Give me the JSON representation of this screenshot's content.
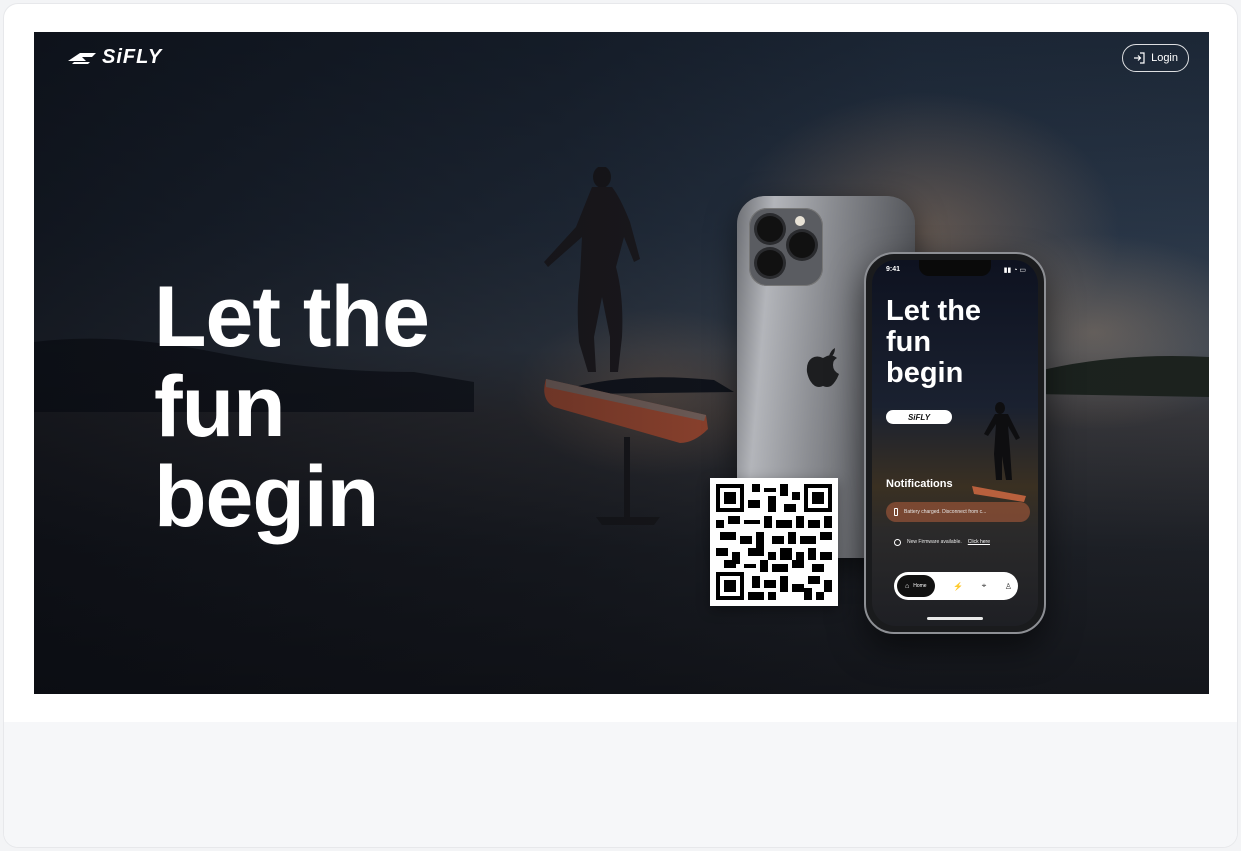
{
  "header": {
    "logo_text": "SiFLY",
    "login_label": "Login",
    "login_icon": "login-icon"
  },
  "hero": {
    "headline": [
      "Let the",
      "fun",
      "begin"
    ]
  },
  "phone_screen": {
    "status_time": "9:41",
    "headline": [
      "Let the",
      "fun",
      "begin"
    ],
    "logo_text": "SiFLY",
    "notifications_title": "Notifications",
    "notifications": [
      {
        "icon": "battery-icon",
        "text": "Battery charged. Disconnect from c..."
      },
      {
        "icon": "firmware-icon",
        "text": "New Firmware available.",
        "link": "Click here"
      }
    ],
    "nav": {
      "home_label": "Home",
      "icons": [
        "foil-icon",
        "map-icon",
        "profile-icon"
      ]
    }
  },
  "qr": {
    "icon": "qr-code"
  },
  "colors": {
    "hero_dark": "#15171c",
    "text_white": "#ffffff",
    "notification_bg": "#b45f3c"
  }
}
